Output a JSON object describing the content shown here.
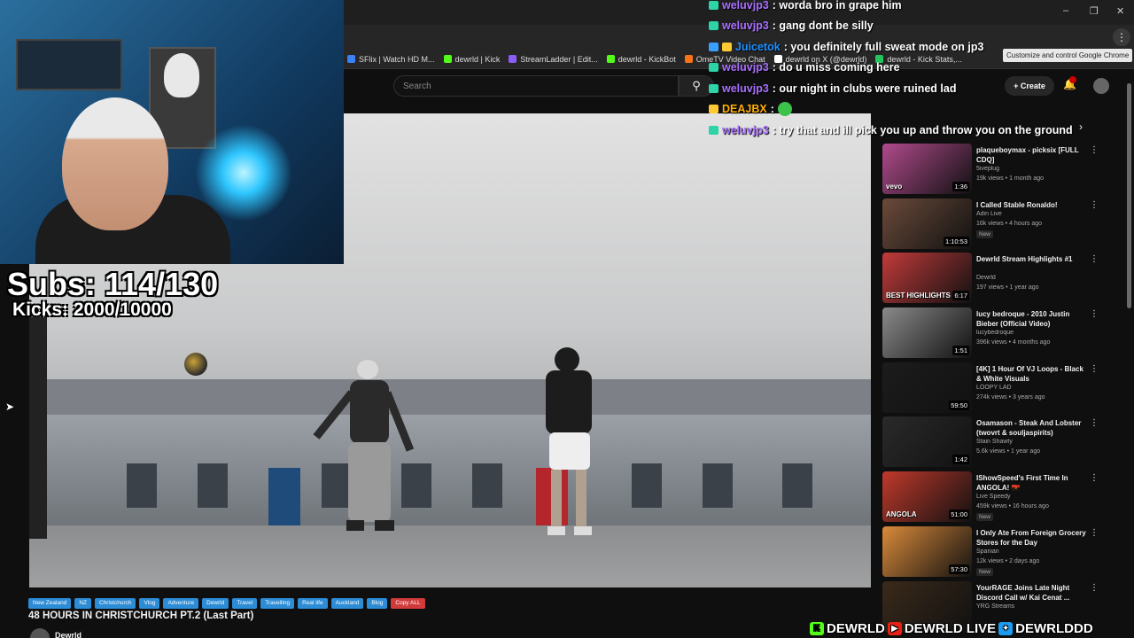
{
  "browser": {
    "bookmarks": [
      {
        "label": "SFlix | Watch HD M...",
        "color": "#3b82f6"
      },
      {
        "label": "dewrld | Kick",
        "color": "#53fc18"
      },
      {
        "label": "StreamLadder | Edit...",
        "color": "#8b5cf6"
      },
      {
        "label": "dewrld - KickBot",
        "color": "#53fc18"
      },
      {
        "label": "OmeTV Video Chat",
        "color": "#f97316"
      },
      {
        "label": "dewrld on X (@dewrld)",
        "color": "#ffffff"
      },
      {
        "label": "dewrld - Kick Stats,...",
        "color": "#22c55e"
      }
    ],
    "tooltip": "Customize and control Google Chrome",
    "window_controls": [
      "–",
      "❐",
      "✕"
    ]
  },
  "youtube": {
    "search_placeholder": "Search",
    "create_label": "Create",
    "video_title": "48 HOURS IN CHRISTCHURCH PT.2 (Last Part)",
    "channel_name": "Dewrld",
    "tags": [
      "New Zealand",
      "NZ",
      "Christchurch",
      "Vlog",
      "Adventure",
      "Dewrld",
      "Travel",
      "Travelling",
      "Real life",
      "Auckland",
      "Blog",
      "Copy ALL"
    ],
    "recommendations": [
      {
        "title": "plaqueboymax - picksix [FULL CDQ]",
        "channel": "5iveplug",
        "views": "19k views • 1 month ago",
        "duration": "1:36",
        "badge": "vevo",
        "thumb_color": "#b04a8c",
        "new": false
      },
      {
        "title": "I Called Stable Ronaldo!",
        "channel": "Adin Live",
        "views": "16k views • 4 hours ago",
        "duration": "1:10:53",
        "badge": "",
        "thumb_color": "#6b4a3a",
        "new": true
      },
      {
        "title": "Dewrld Stream Highlights #1",
        "channel": "Dewrld",
        "views": "197 views • 1 year ago",
        "duration": "6:17",
        "badge": "BEST HIGHLIGHTS",
        "thumb_color": "#c23a3a",
        "new": false
      },
      {
        "title": "lucy bedroque - 2010 Justin Bieber (Official Video)",
        "channel": "lucybedroque",
        "views": "396k views • 4 months ago",
        "duration": "1:51",
        "badge": "",
        "thumb_color": "#8a8a8a",
        "new": false
      },
      {
        "title": "[4K] 1 Hour Of VJ Loops - Black & White Visuals",
        "channel": "LOOPY LAD",
        "views": "274k views • 3 years ago",
        "duration": "59:50",
        "badge": "",
        "thumb_color": "#1c1c1c",
        "new": false
      },
      {
        "title": "Osamason - Steak And Lobster (twovrt & souljaspirits)",
        "channel": "Stain Shawty",
        "views": "5.6k views • 1 year ago",
        "duration": "1:42",
        "badge": "",
        "thumb_color": "#2a2a2a",
        "new": false
      },
      {
        "title": "IShowSpeed's First Time In ANGOLA! 🇦🇴",
        "channel": "Live Speedy",
        "views": "459k views • 16 hours ago",
        "duration": "51:00",
        "badge": "ANGOLA",
        "thumb_color": "#c0392b",
        "new": true
      },
      {
        "title": "I Only Ate From Foreign Grocery Stores for the Day",
        "channel": "Spanian",
        "views": "12k views • 2 days ago",
        "duration": "57:30",
        "badge": "",
        "thumb_color": "#d98a3a",
        "new": true
      },
      {
        "title": "YourRAGE Joins Late Night Discord Call w/ Kai Cenat ...",
        "channel": "YRG Streams",
        "views": "",
        "duration": "",
        "badge": "",
        "thumb_color": "#3a2a1a",
        "new": false
      }
    ]
  },
  "stream_overlay": {
    "subs": "Subs: 114/130",
    "kicks": "Kicks: 2000/10000",
    "chat": [
      {
        "user": "weluvjp3",
        "message": ": worda bro in grape him",
        "color": "#a970ff"
      },
      {
        "user": "weluvjp3",
        "message": ": gang dont be silly",
        "color": "#a970ff"
      },
      {
        "user": "Juicetok",
        "message": ": you definitely full sweat mode on jp3",
        "color": "#1e90ff"
      },
      {
        "user": "weluvjp3",
        "message": ": do u miss coming here",
        "color": "#a970ff"
      },
      {
        "user": "weluvjp3",
        "message": ": our night in clubs were ruined lad",
        "color": "#a970ff"
      },
      {
        "user": "DEAJBX",
        "message": ":",
        "color": "#ffb000"
      },
      {
        "user": "weluvjp3",
        "message": ": try that and ill pick you up and throw you on the ground",
        "color": "#a970ff"
      }
    ],
    "socials": [
      "DEWRLD",
      "DEWRLD LIVE",
      "DEWRLDDD"
    ]
  }
}
